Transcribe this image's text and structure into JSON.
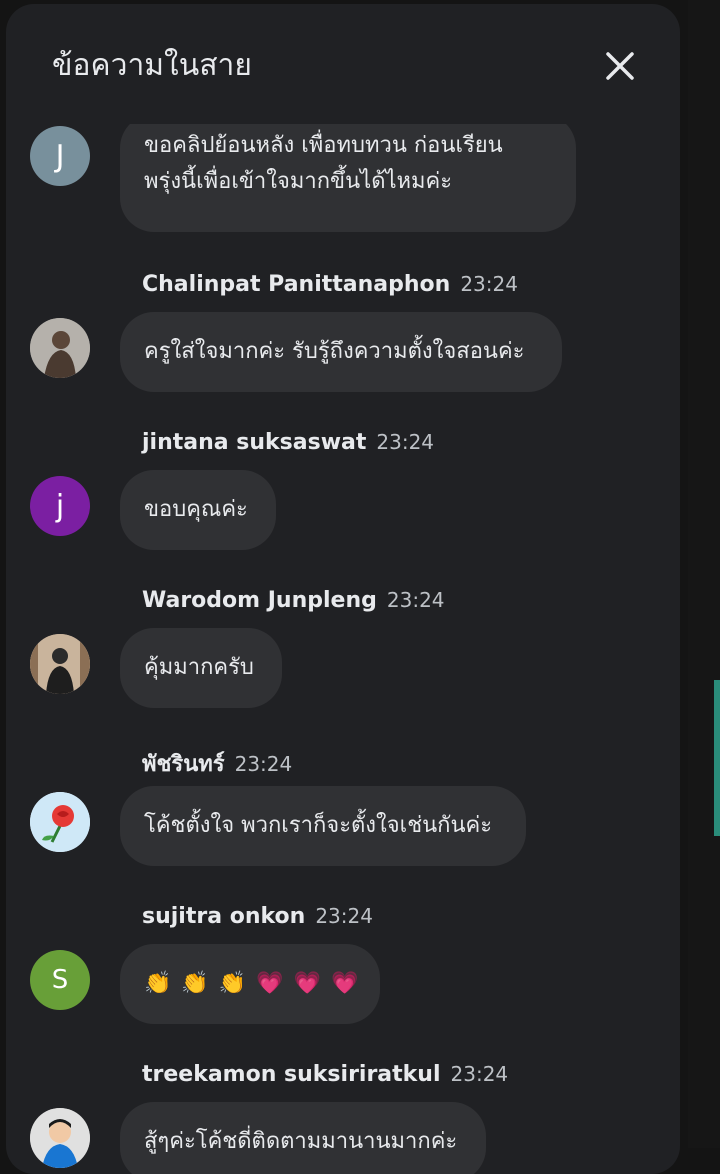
{
  "header": {
    "title": "ข้อความในสาย",
    "close_icon": "close-icon"
  },
  "colors": {
    "panel_bg": "#202124",
    "bubble_bg": "#303134",
    "text_primary": "#e8eaed",
    "text_secondary": "#bdc1c6",
    "accent_scroll": "#2a8c7a"
  },
  "messages": [
    {
      "author": "",
      "time": "",
      "avatar_letter": "J",
      "avatar_color": "#78909c",
      "text_lines": [
        "ขอคลิปย้อนหลัง เพื่อทบทวน ก่อนเรียน",
        "พรุ่งนี้เพื่อเข้าใจมากขึ้นได้ไหมค่ะ"
      ]
    },
    {
      "author": "Chalinpat Panittanaphon",
      "time": "23:24",
      "avatar_letter": "",
      "avatar_color": "#8d8a86",
      "text_lines": [
        "ครูใส่ใจมากค่ะ รับรู้ถึงความตั้งใจสอนค่ะ"
      ]
    },
    {
      "author": "jintana suksaswat",
      "time": "23:24",
      "avatar_letter": "j",
      "avatar_color": "#7b1fa2",
      "text_lines": [
        "ขอบคุณค่ะ"
      ]
    },
    {
      "author": "Warodom Junpleng",
      "time": "23:24",
      "avatar_letter": "",
      "avatar_color": "#b9a08a",
      "text_lines": [
        "คุ้มมากครับ"
      ]
    },
    {
      "author": "พัชรินทร์",
      "time": "23:24",
      "avatar_letter": "",
      "avatar_color": "#cfe8f7",
      "text_lines": [
        "โค้ชตั้งใจ พวกเราก็จะตั้งใจเช่นกันค่ะ"
      ]
    },
    {
      "author": "sujitra onkon",
      "time": "23:24",
      "avatar_letter": "S",
      "avatar_color": "#689f38",
      "text_lines": [],
      "emojis": [
        "👏",
        "👏",
        "👏",
        "💗",
        "💗",
        "💗"
      ]
    },
    {
      "author": "treekamon suksiriratkul",
      "time": "23:24",
      "avatar_letter": "",
      "avatar_color": "#9e9e9e",
      "text_lines": [
        "สู้ๆค่ะโค้ชดี่ติดตามมานานมากค่ะ"
      ]
    }
  ]
}
